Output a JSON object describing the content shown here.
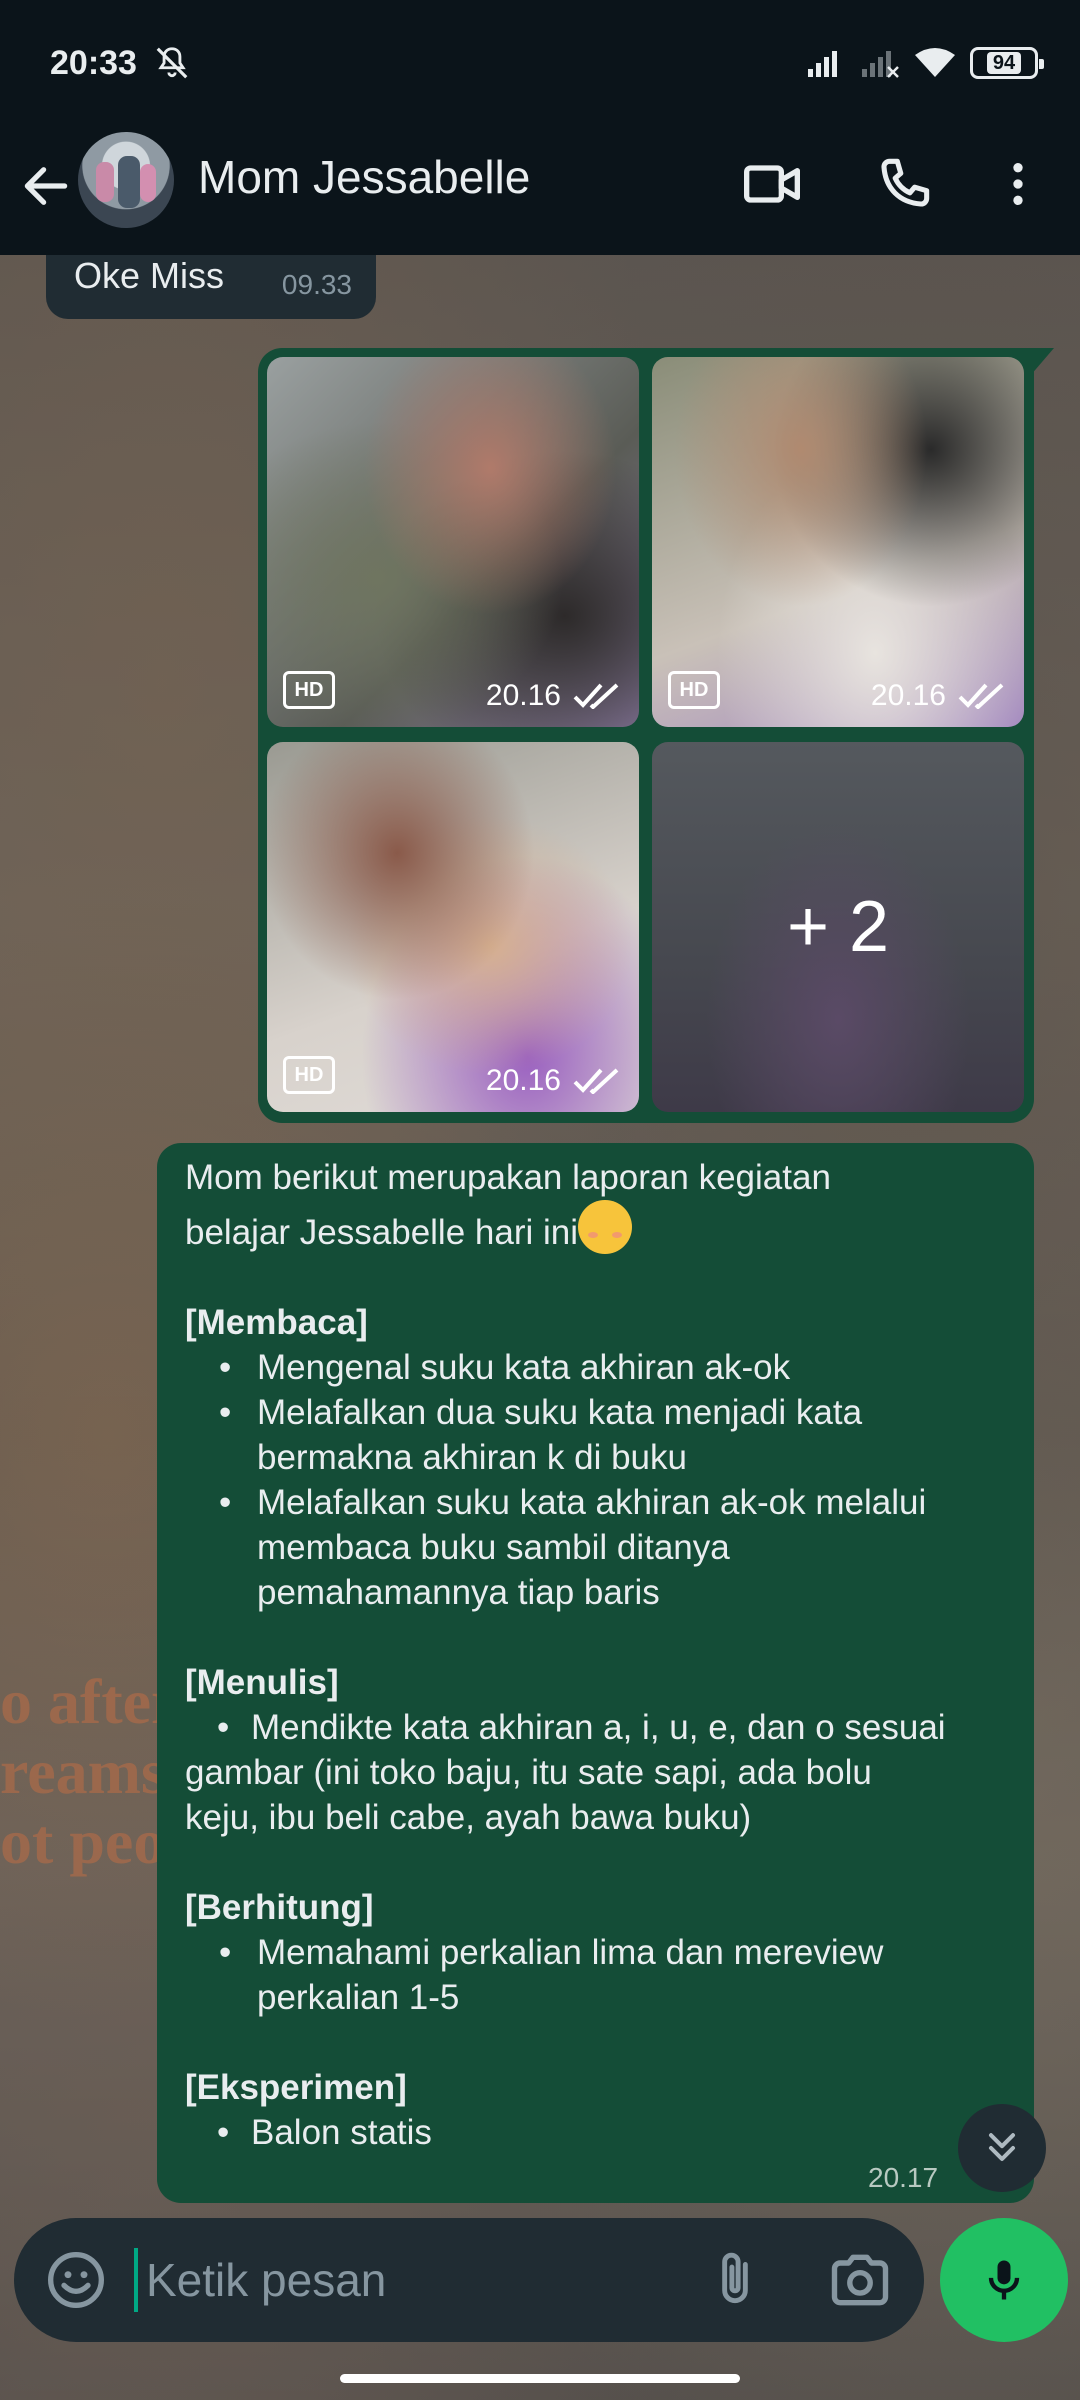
{
  "status_bar": {
    "time": "20:33",
    "battery": "94",
    "icons": [
      "mute-icon",
      "signal-icon",
      "signal-off-icon",
      "wifi-icon",
      "battery-icon"
    ]
  },
  "header": {
    "contact_name": "Mom Jessabelle",
    "icons": [
      "back-arrow-icon",
      "video-call-icon",
      "phone-icon",
      "more-vert-icon"
    ]
  },
  "messages": {
    "incoming": {
      "text": "Oke Miss",
      "time": "09.33"
    },
    "album": {
      "tiles": [
        {
          "hd": "HD",
          "time": "20.16"
        },
        {
          "hd": "HD",
          "time": "20.16"
        },
        {
          "hd": "HD",
          "time": "20.16"
        },
        {
          "more": "+ 2"
        }
      ]
    },
    "report": {
      "intro_1": "Mom berikut merupakan laporan kegiatan",
      "intro_2": "belajar Jessabelle hari ini",
      "membaca_head": "[Membaca]",
      "membaca_1": "Mengenal suku kata akhiran ak-ok",
      "membaca_2a": "Melafalkan dua suku kata menjadi kata",
      "membaca_2b": "bermakna akhiran k di buku",
      "membaca_3a": "Melafalkan suku kata akhiran ak-ok melalui",
      "membaca_3b": "membaca buku sambil ditanya",
      "membaca_3c": "pemahamannya tiap baris",
      "menulis_head": "[Menulis]",
      "menulis_1": "Mendikte kata akhiran a, i, u, e, dan o sesuai",
      "menulis_2": "gambar (ini toko baju, itu sate sapi, ada bolu",
      "menulis_3": "keju, ibu beli cabe, ayah bawa buku)",
      "berhitung_head": "[Berhitung]",
      "berhitung_1a": "Memahami perkalian lima dan mereview",
      "berhitung_1b": "perkalian 1-5",
      "eksperimen_head": "[Eksperimen]",
      "eksperimen_1": "Balon statis",
      "bullet": "•",
      "time": "20.17"
    }
  },
  "input": {
    "placeholder": "Ketik pesan",
    "icons": [
      "emoji-icon",
      "attach-icon",
      "camera-icon",
      "mic-icon"
    ]
  },
  "background_text": [
    "o after",
    "reams",
    "ot peop"
  ],
  "colors": {
    "app_bg": "#0b141a",
    "outgoing_bubble": "#144d37",
    "incoming_bubble": "#202c33",
    "accent_green": "#21c063",
    "muted_text": "#8696a0"
  }
}
